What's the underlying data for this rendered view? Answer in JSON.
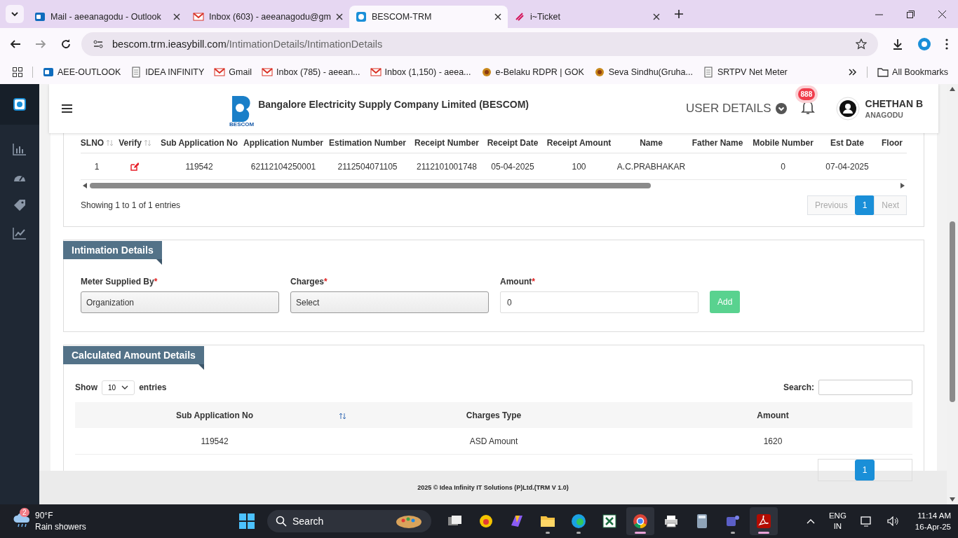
{
  "browser": {
    "tabs": [
      {
        "title": "Mail - aeeanagodu - Outlook",
        "kind": "mail",
        "selected": false
      },
      {
        "title": "Inbox (603) - aeeanagodu@gm",
        "kind": "gmail",
        "selected": false
      },
      {
        "title": "BESCOM-TRM",
        "kind": "site",
        "selected": true
      },
      {
        "title": "i~Ticket",
        "kind": "ticket",
        "selected": false
      }
    ],
    "url_domain": "bescom.trm.ieasybill.com",
    "url_path": "/IntimationDetails/IntimationDetails",
    "bookmarks": [
      {
        "label": "AEE-OUTLOOK",
        "kind": "mail"
      },
      {
        "label": "IDEA INFINITY",
        "kind": "page"
      },
      {
        "label": "Gmail",
        "kind": "gmail"
      },
      {
        "label": "Inbox (785) - aeean...",
        "kind": "gmail"
      },
      {
        "label": "Inbox (1,150) - aeea...",
        "kind": "gmail"
      },
      {
        "label": "e-Belaku RDPR | GOK",
        "kind": "emblem"
      },
      {
        "label": "Seva Sindhu(Gruha...",
        "kind": "emblem"
      },
      {
        "label": "SRTPV Net Meter",
        "kind": "page"
      }
    ],
    "all_bookmarks": "All Bookmarks"
  },
  "header": {
    "logo_caption": "BESCOM",
    "company": "Bangalore Electricity Supply Company Limited (BESCOM)",
    "user_details": "USER DETAILS",
    "notification_count": "888",
    "user_name": "CHETHAN B",
    "user_location": "ANAGODU"
  },
  "applications_table": {
    "columns": [
      {
        "label": "SLNO",
        "sortable": true
      },
      {
        "label": "Verify",
        "sortable": true
      },
      {
        "label": "Sub Application No",
        "sortable": false
      },
      {
        "label": "Application Number",
        "sortable": false
      },
      {
        "label": "Estimation Number",
        "sortable": false
      },
      {
        "label": "Receipt Number",
        "sortable": false
      },
      {
        "label": "Receipt Date",
        "sortable": false
      },
      {
        "label": "Receipt Amount",
        "sortable": false
      },
      {
        "label": "Name",
        "sortable": false
      },
      {
        "label": "Father Name",
        "sortable": false
      },
      {
        "label": "Mobile Number",
        "sortable": false
      },
      {
        "label": "Est Date",
        "sortable": false
      },
      {
        "label": "Floor",
        "sortable": false
      }
    ],
    "rows": [
      [
        {
          "kind": "text",
          "text": "1"
        },
        {
          "kind": "edit"
        },
        {
          "kind": "text",
          "text": "119542"
        },
        {
          "kind": "text",
          "text": "62112104250001"
        },
        {
          "kind": "text",
          "text": "2112504071105"
        },
        {
          "kind": "text",
          "text": "2112101001748"
        },
        {
          "kind": "text",
          "text": "05-04-2025"
        },
        {
          "kind": "text",
          "text": "100"
        },
        {
          "kind": "text",
          "text": "A.C.PRABHAKAR"
        },
        {
          "kind": "blank"
        },
        {
          "kind": "text",
          "text": "0"
        },
        {
          "kind": "text",
          "text": "07-04-2025"
        },
        {
          "kind": "blank"
        }
      ]
    ],
    "showing": "Showing 1 to 1 of 1 entries",
    "pagination": {
      "previous": "Previous",
      "previous_disabled": true,
      "pages": [
        {
          "label": "1",
          "selected": true
        }
      ],
      "next": "Next",
      "next_disabled": true
    }
  },
  "intimation": {
    "title": "Intimation Details",
    "fields": [
      {
        "label": "Meter Supplied By",
        "required_mark": "*",
        "kind": "select",
        "value": "Organization"
      },
      {
        "label": "Charges",
        "required_mark": "*",
        "kind": "select",
        "value": "Select"
      },
      {
        "label": "Amount",
        "required_mark": "*",
        "kind": "input",
        "value": "0"
      }
    ],
    "add_button": "Add"
  },
  "calculated": {
    "title": "Calculated Amount Details",
    "show_label": "Show",
    "page_size": "10",
    "entries_label": "entries",
    "search_label": "Search:",
    "columns": [
      {
        "label": "Sub Application No",
        "sortable": true
      },
      {
        "label": "Charges Type",
        "sortable": false
      },
      {
        "label": "Amount",
        "sortable": false
      }
    ],
    "rows": [
      [
        "119542",
        "ASD Amount",
        "1620"
      ]
    ],
    "pages": [
      {
        "label": "1",
        "selected": true
      }
    ]
  },
  "footer": "2025 © Idea Infinity IT Solutions (P)Ltd.(TRM V 1.0)",
  "taskbar": {
    "weather_badge": "2",
    "temperature": "90°F",
    "condition": "Rain showers",
    "search": "Search",
    "apps": [
      {
        "kind": "taskview",
        "open": false,
        "active": false
      },
      {
        "kind": "paint",
        "open": false,
        "active": false
      },
      {
        "kind": "copilot",
        "open": false,
        "active": false
      },
      {
        "kind": "folder",
        "open": true,
        "active": false
      },
      {
        "kind": "edge",
        "open": true,
        "active": false
      },
      {
        "kind": "sheet",
        "open": false,
        "active": false
      },
      {
        "kind": "chrome",
        "open": true,
        "active": true
      },
      {
        "kind": "printer",
        "open": false,
        "active": false
      },
      {
        "kind": "calculator",
        "open": false,
        "active": false
      },
      {
        "kind": "teams",
        "open": true,
        "active": false
      },
      {
        "kind": "pdf",
        "open": true,
        "active": true
      }
    ],
    "language": "ENG",
    "region": "IN",
    "time": "11:14 AM",
    "date": "16-Apr-25"
  }
}
